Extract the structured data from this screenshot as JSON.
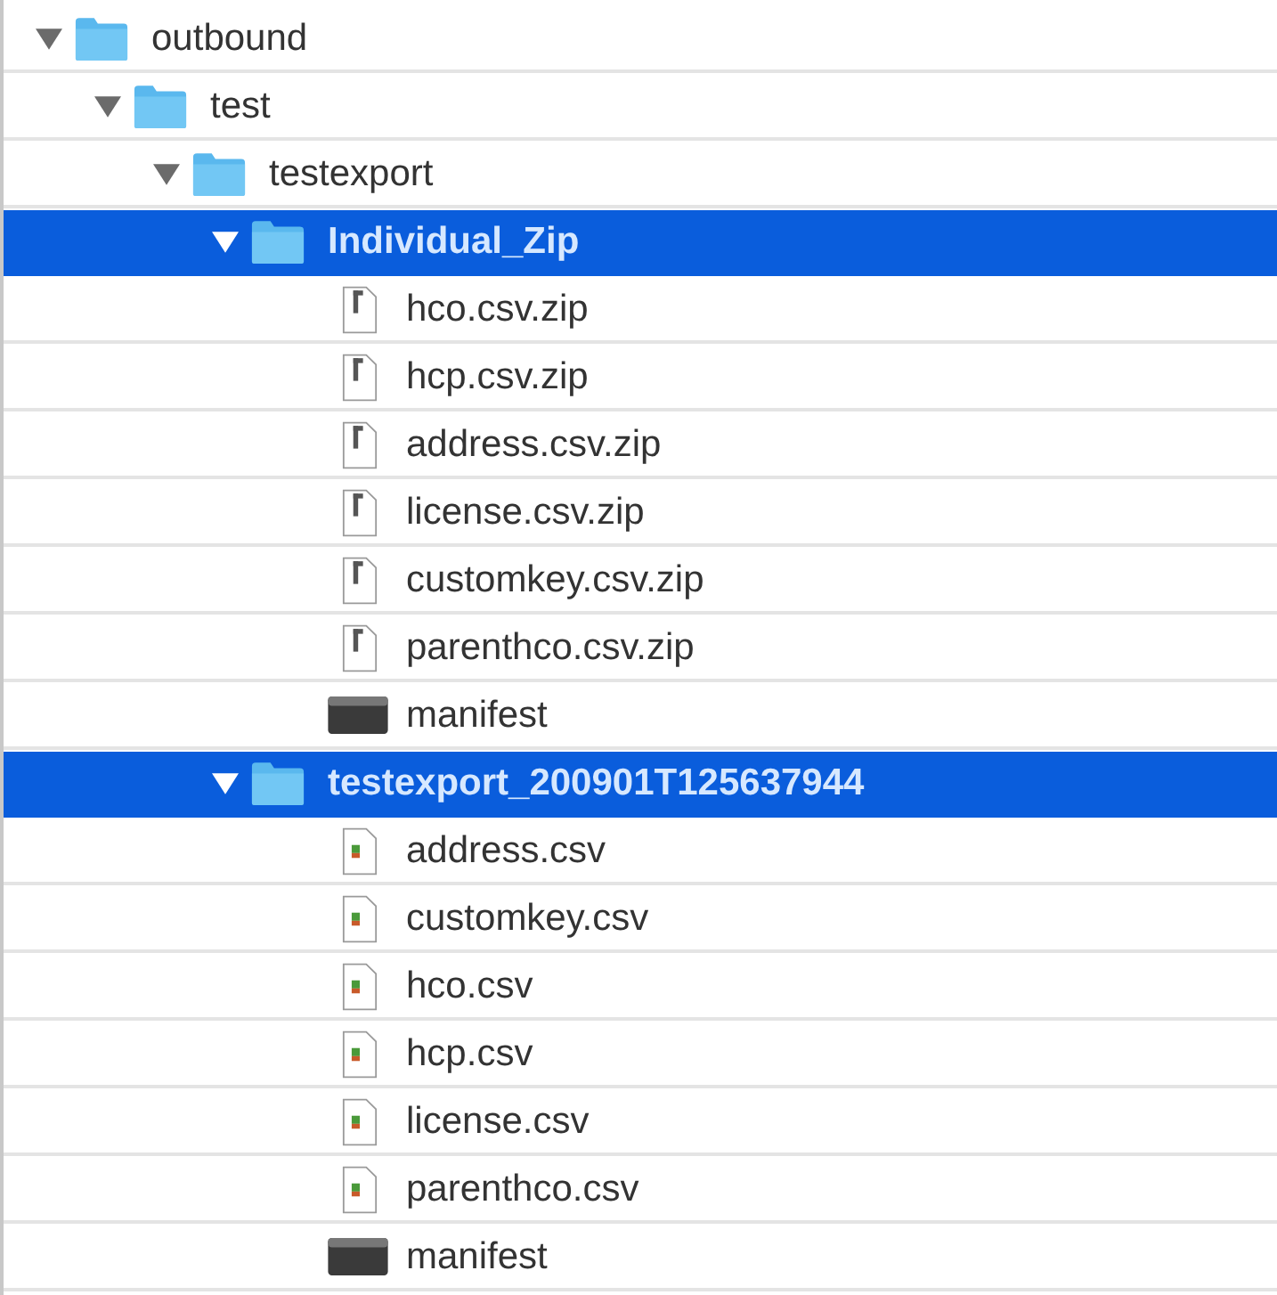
{
  "tree": [
    {
      "kind": "folder",
      "name": "outbound",
      "expanded": true,
      "selected": false,
      "children": [
        {
          "kind": "folder",
          "name": "test",
          "expanded": true,
          "selected": false,
          "children": [
            {
              "kind": "folder",
              "name": "testexport",
              "expanded": true,
              "selected": false,
              "children": [
                {
                  "kind": "folder",
                  "name": "Individual_Zip",
                  "expanded": true,
                  "selected": true,
                  "children": [
                    {
                      "kind": "zip",
                      "name": "hco.csv.zip"
                    },
                    {
                      "kind": "zip",
                      "name": "hcp.csv.zip"
                    },
                    {
                      "kind": "zip",
                      "name": "address.csv.zip"
                    },
                    {
                      "kind": "zip",
                      "name": "license.csv.zip"
                    },
                    {
                      "kind": "zip",
                      "name": "customkey.csv.zip"
                    },
                    {
                      "kind": "zip",
                      "name": "parenthco.csv.zip"
                    },
                    {
                      "kind": "exec",
                      "name": "manifest"
                    }
                  ]
                },
                {
                  "kind": "folder",
                  "name": "testexport_200901T125637944",
                  "expanded": true,
                  "selected": true,
                  "children": [
                    {
                      "kind": "csv",
                      "name": "address.csv"
                    },
                    {
                      "kind": "csv",
                      "name": "customkey.csv"
                    },
                    {
                      "kind": "csv",
                      "name": "hco.csv"
                    },
                    {
                      "kind": "csv",
                      "name": "hcp.csv"
                    },
                    {
                      "kind": "csv",
                      "name": "license.csv"
                    },
                    {
                      "kind": "csv",
                      "name": "parenthco.csv"
                    },
                    {
                      "kind": "exec",
                      "name": "manifest"
                    }
                  ]
                }
              ]
            }
          ]
        }
      ]
    }
  ]
}
